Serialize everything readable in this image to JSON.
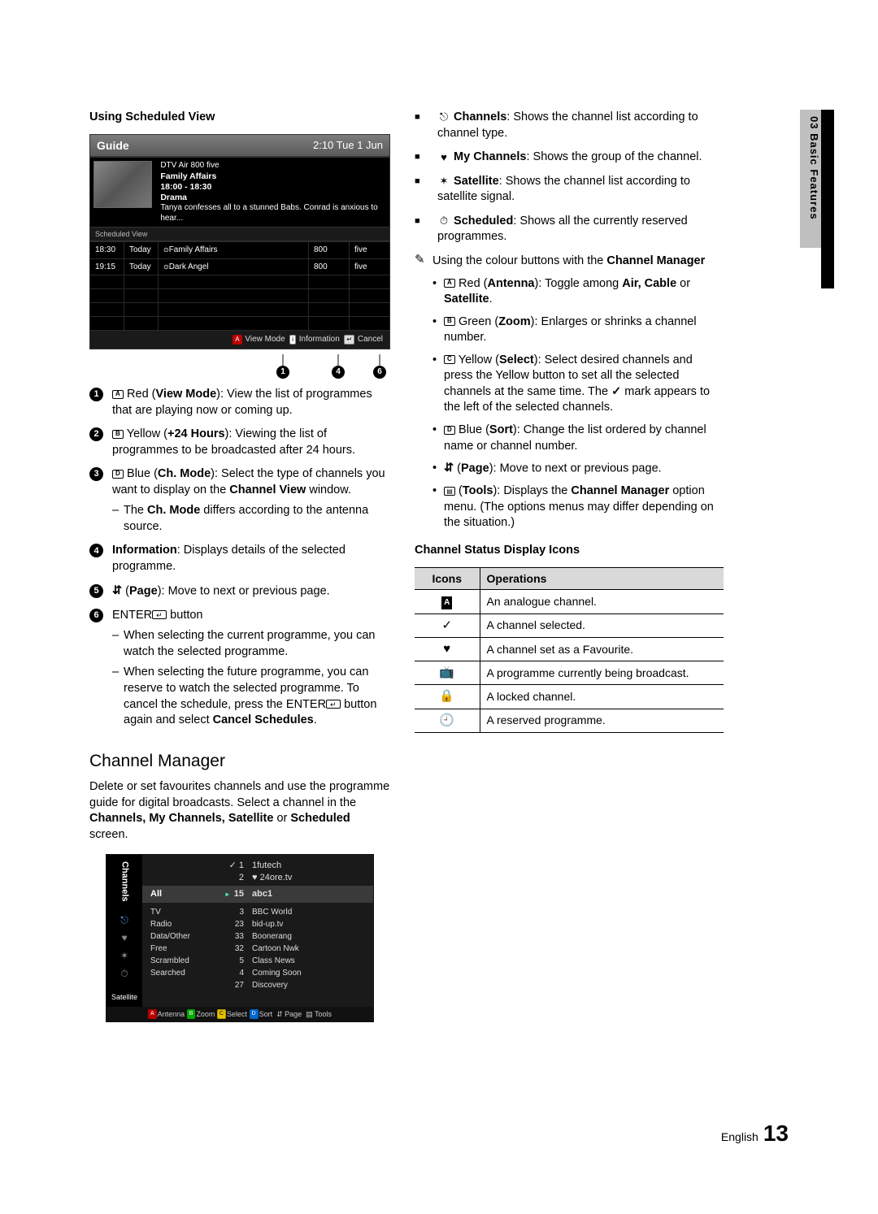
{
  "side_tab": "03   Basic Features",
  "left": {
    "heading": "Using Scheduled View",
    "guide": {
      "title": "Guide",
      "clock": "2:10 Tue 1 Jun",
      "source": "DTV Air 800 five",
      "prog_title": "Family Affairs",
      "prog_time": "18:00 - 18:30",
      "prog_genre": "Drama",
      "prog_desc": "Tanya confesses all to a stunned Babs. Conrad is anxious to hear...",
      "sched_label": "Scheduled View",
      "rows": [
        {
          "time": "18:30",
          "day": "Today",
          "title": "Family Affairs",
          "num": "800",
          "ch": "five"
        },
        {
          "time": "19:15",
          "day": "Today",
          "title": "Dark Angel",
          "num": "800",
          "ch": "five"
        }
      ],
      "bottom": {
        "view_mode": "View Mode",
        "info": "Information",
        "cancel": "Cancel"
      },
      "pointers": [
        "1",
        "4",
        "6"
      ]
    },
    "items": [
      {
        "num": "1",
        "html": "<span class='inline-pad a'></span> Red (<b>View Mode</b>): View the list of programmes that are playing now or coming up."
      },
      {
        "num": "2",
        "html": "<span class='inline-pad b-b'></span> Yellow (<b>+24 Hours</b>): Viewing the list of programmes to be broadcasted after 24 hours."
      },
      {
        "num": "3",
        "html": "<span class='inline-pad d'></span> Blue (<b>Ch. Mode</b>): Select the type of channels you want to display on the <b>Channel View</b> window.",
        "sub": [
          "The <b>Ch. Mode</b> differs according to the antenna source."
        ]
      },
      {
        "num": "4",
        "html": "<b>Information</b>: Displays details of the selected programme."
      },
      {
        "num": "5",
        "html": "<span class='inline-updown'></span> (<b>Page</b>): Move to next or previous page."
      },
      {
        "num": "6",
        "html": "ENTER<span class='inline-pad enter'></span> button",
        "sub": [
          "When selecting the current programme, you can watch the selected programme.",
          "When selecting the future programme, you can reserve to watch the selected programme. To cancel the schedule, press the ENTER<span class='inline-pad enter'></span> button again and select <b>Cancel Schedules</b>."
        ]
      }
    ],
    "cm_heading": "Channel Manager",
    "cm_intro": "Delete or set favourites channels and use the programme guide for digital broadcasts. Select a channel in the <b>Channels, My Channels, Satellite</b> or <b>Scheduled</b> screen.",
    "cm": {
      "side_label": "Channels",
      "satellite": "Satellite",
      "top_rows": [
        {
          "mark": "✓",
          "num": "1",
          "name": "1futech"
        },
        {
          "mark": "",
          "num": "2",
          "name": "♥ 24ore.tv"
        }
      ],
      "all_label": "All",
      "sel_num": "15",
      "sel_name": "abc1",
      "cats": [
        "TV",
        "Radio",
        "Data/Other",
        "Free",
        "Scrambled",
        "Searched"
      ],
      "nums": [
        "3",
        "23",
        "33",
        "32",
        "5",
        "4",
        "27"
      ],
      "names": [
        "BBC World",
        "bid-up.tv",
        "Boonerang",
        "Cartoon Nwk",
        "Class News",
        "Coming Soon",
        "Discovery"
      ],
      "bottom": {
        "ant": "Antenna",
        "zoom": "Zoom",
        "select": "Select",
        "sort": "Sort",
        "page": "Page",
        "tools": "Tools"
      }
    }
  },
  "right": {
    "toplist": [
      {
        "ico": "⎋",
        "html": "<b>Channels</b>: Shows the channel list according to channel type."
      },
      {
        "ico": "♥",
        "html": "<b>My Channels</b>: Shows the group of the channel."
      },
      {
        "ico": "✶",
        "html": "<b>Satellite</b>: Shows the channel list according to satellite signal."
      },
      {
        "ico": "⏱",
        "html": "<b>Scheduled</b>: Shows all the currently reserved programmes."
      }
    ],
    "note": "Using the colour buttons with the <b>Channel Manager</b>",
    "dots": [
      "<span class='inline-pad a'></span> Red (<b>Antenna</b>): Toggle among <b>Air, Cable</b> or <b>Satellite</b>.",
      "<span class='inline-pad b-b'></span> Green (<b>Zoom</b>): Enlarges or shrinks a channel number.",
      "<span class='inline-pad c'></span> Yellow (<b>Select</b>): Select desired channels and press the Yellow button to set all the selected channels at the same time. The <span class='check-inline'></span> mark appears to the left of the selected channels.",
      "<span class='inline-pad d'></span> Blue (<b>Sort</b>): Change the list ordered by channel name or channel number.",
      "<span class='inline-updown'></span> (<b>Page</b>): Move to next or previous page.",
      "<span class='inline-tools'></span> (<b>Tools</b>): Displays the <b>Channel Manager</b> option menu. (The options menus may differ depending on the situation.)"
    ],
    "status_head": "Channel Status Display Icons",
    "status_cols": [
      "Icons",
      "Operations"
    ],
    "status": [
      {
        "icon": "icon-a",
        "op": "An analogue channel."
      },
      {
        "icon": "✓",
        "op": "A channel selected."
      },
      {
        "icon": "♥",
        "op": "A channel set as a Favourite."
      },
      {
        "icon": "📺",
        "op": "A programme currently being broadcast."
      },
      {
        "icon": "🔒",
        "op": "A locked channel."
      },
      {
        "icon": "🕘",
        "op": "A reserved programme."
      }
    ]
  },
  "footer": {
    "lang": "English",
    "page": "13"
  }
}
